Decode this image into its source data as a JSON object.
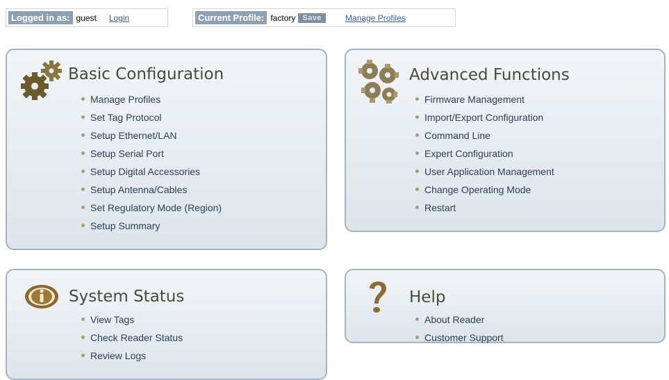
{
  "login": {
    "label": "Logged in as:",
    "user": "guest",
    "login_link": "Login"
  },
  "profile": {
    "label": "Current Profile:",
    "name": "factory",
    "save_label": "Save",
    "manage_link": "Manage Profiles"
  },
  "panels": {
    "basic": {
      "title": "Basic Configuration",
      "icon": "gears-icon",
      "items": [
        "Manage Profiles",
        "Set Tag Protocol",
        "Setup Ethernet/LAN",
        "Setup Serial Port",
        "Setup Digital Accessories",
        "Setup Antenna/Cables",
        "Set Regulatory Mode (Region)",
        "Setup Summary"
      ]
    },
    "advanced": {
      "title": "Advanced Functions",
      "icon": "gears-cluster-icon",
      "items": [
        "Firmware Management",
        "Import/Export Configuration",
        "Command Line",
        "Expert Configuration",
        "User Application Management",
        "Change Operating Mode",
        "Restart"
      ]
    },
    "status": {
      "title": "System Status",
      "icon": "info-icon",
      "items": [
        "View Tags",
        "Check Reader Status",
        "Review Logs"
      ]
    },
    "help": {
      "title": "Help",
      "icon": "question-mark-icon",
      "items": [
        "About Reader",
        "Customer Support"
      ]
    }
  }
}
